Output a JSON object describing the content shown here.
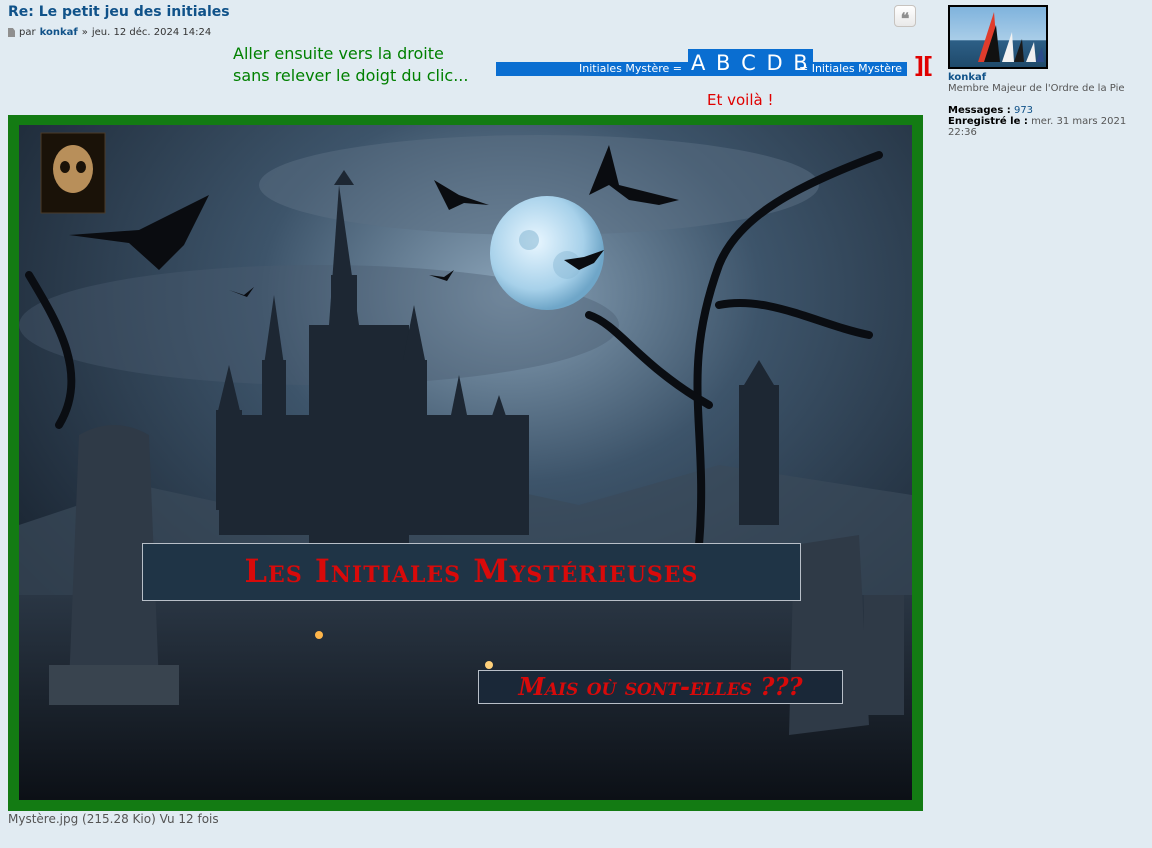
{
  "post": {
    "title": "Re: Le petit jeu des initiales",
    "meta_prefix": "par",
    "author": "konkaf",
    "meta_sep": "»",
    "date": "jeu. 12 déc. 2024 14:24",
    "quote_icon": "quote-icon"
  },
  "hint": {
    "line1": "Aller ensuite vers la droite",
    "line2": "sans relever le doigt du clic..."
  },
  "selection": {
    "left_text": "Initiales Mystère =",
    "letters": "A B C D B",
    "right_text": "= Initiales Mystère",
    "brackets": "][",
    "result": "Et voilà !"
  },
  "attachment": {
    "title_text": "Les Initiales Mystérieuses",
    "subtitle_text": "Mais où sont-elles ???",
    "file_caption": "Mystère.jpg (215.28 Kio) Vu 12 fois"
  },
  "profile": {
    "username": "konkaf",
    "rank": "Membre Majeur de l'Ordre de la Pie",
    "messages_label": "Messages :",
    "messages_value": "973",
    "registered_label": "Enregistré le :",
    "registered_value": "mer. 31 mars 2021 22:36"
  },
  "colors": {
    "background": "#e1ebf2",
    "link": "#105289",
    "hint_green": "#008000",
    "selection_blue": "#0a6ed1",
    "accent_red": "#e00000",
    "frame_green": "#137b13"
  }
}
